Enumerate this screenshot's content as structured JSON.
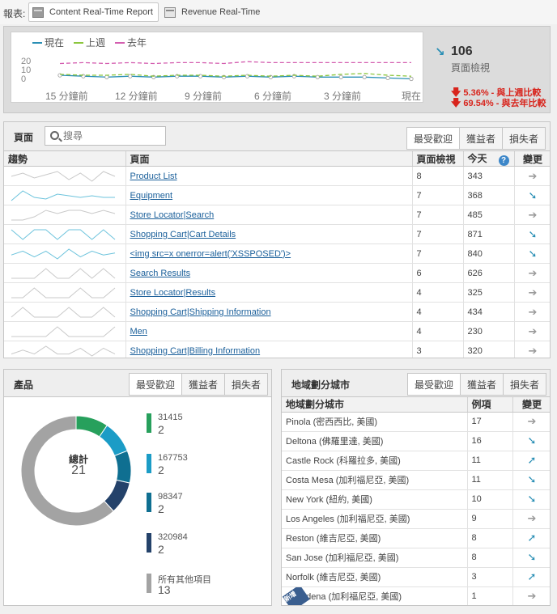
{
  "report": {
    "label": "報表:",
    "tabs": [
      {
        "label": "Content Real-Time Report",
        "active": true
      },
      {
        "label": "Revenue Real-Time",
        "active": false
      }
    ]
  },
  "overview": {
    "legend": [
      {
        "name": "現在",
        "color": "#2a8fb5"
      },
      {
        "name": "上週",
        "color": "#8cc63e"
      },
      {
        "name": "去年",
        "color": "#d45fb0"
      }
    ],
    "y_ticks": [
      "20",
      "10",
      "0"
    ],
    "x_ticks": [
      "15 分鐘前",
      "12 分鐘前",
      "9 分鐘前",
      "6 分鐘前",
      "3 分鐘前",
      "現在"
    ],
    "kpi_arrow": "↘",
    "kpi_value": "106",
    "kpi_label": "頁面檢視",
    "comparisons": [
      {
        "arrow": "🡇",
        "text": "5.36% - 與上週比較"
      },
      {
        "arrow": "🡇",
        "text": "69.54% - 與去年比較"
      }
    ],
    "chart_data": {
      "type": "line",
      "x": [
        "15 分鐘前",
        "12 分鐘前",
        "9 分鐘前",
        "6 分鐘前",
        "3 分鐘前",
        "現在"
      ],
      "ylim": [
        0,
        25
      ],
      "series": [
        {
          "name": "現在",
          "color": "#2a8fb5",
          "values": [
            8,
            7,
            6,
            7,
            6,
            7,
            7,
            6,
            7,
            6,
            7,
            6,
            6,
            6,
            5,
            4
          ]
        },
        {
          "name": "上週",
          "color": "#8cc63e",
          "values": [
            9,
            8,
            8,
            9,
            7,
            8,
            8,
            7,
            8,
            7,
            8,
            7,
            9,
            10,
            8,
            7
          ]
        },
        {
          "name": "去年",
          "color": "#d45fb0",
          "values": [
            21,
            22,
            21,
            22,
            21,
            22,
            22,
            21,
            23,
            22,
            22,
            22,
            22,
            22,
            22,
            22
          ]
        }
      ]
    }
  },
  "pages": {
    "title": "頁面",
    "search_placeholder": "搜尋",
    "tabs": [
      "最受歡迎",
      "獲益者",
      "損失者"
    ],
    "columns": [
      "趨勢",
      "頁面",
      "頁面檢視",
      "今天",
      "變更"
    ],
    "rows": [
      {
        "page": "Product List",
        "views": "8",
        "today": "343",
        "change": "flat",
        "spark": [
          6,
          8,
          5,
          7,
          9,
          4,
          8,
          3,
          9,
          6
        ]
      },
      {
        "page": "Equipment",
        "views": "7",
        "today": "368",
        "change": "down",
        "spark": [
          3,
          9,
          5,
          4,
          7,
          6,
          5,
          6,
          5,
          5
        ]
      },
      {
        "page": "Store Locator|Search",
        "views": "7",
        "today": "485",
        "change": "flat",
        "spark": [
          5,
          5,
          6,
          8,
          7,
          8,
          8,
          7,
          8,
          7
        ]
      },
      {
        "page": "Shopping Cart|Cart Details",
        "views": "7",
        "today": "871",
        "change": "down",
        "spark": [
          8,
          3,
          8,
          8,
          3,
          8,
          8,
          3,
          8,
          3
        ]
      },
      {
        "page": "<img src=x onerror=alert('XSSPOSED')>",
        "views": "7",
        "today": "840",
        "change": "down",
        "spark": [
          5,
          7,
          4,
          7,
          3,
          8,
          4,
          7,
          5,
          6
        ]
      },
      {
        "page": "Search Results",
        "views": "6",
        "today": "626",
        "change": "flat",
        "spark": [
          5,
          5,
          5,
          8,
          5,
          5,
          8,
          5,
          8,
          5
        ]
      },
      {
        "page": "Store Locator|Results",
        "views": "4",
        "today": "325",
        "change": "flat",
        "spark": [
          5,
          5,
          8,
          5,
          5,
          5,
          8,
          5,
          5,
          8
        ]
      },
      {
        "page": "Shopping Cart|Shipping Information",
        "views": "4",
        "today": "434",
        "change": "flat",
        "spark": [
          5,
          8,
          5,
          5,
          5,
          8,
          5,
          5,
          8,
          5
        ]
      },
      {
        "page": "Men",
        "views": "4",
        "today": "230",
        "change": "flat",
        "spark": [
          5,
          5,
          5,
          5,
          8,
          5,
          5,
          5,
          5,
          8
        ]
      },
      {
        "page": "Shopping Cart|Billing Information",
        "views": "3",
        "today": "320",
        "change": "flat",
        "spark": [
          5,
          7,
          5,
          9,
          5,
          5,
          8,
          4,
          8,
          5
        ]
      }
    ]
  },
  "products": {
    "title": "產品",
    "tabs": [
      "最受歡迎",
      "獲益者",
      "損失者"
    ],
    "total_label": "總計",
    "total_value": "21",
    "chart_data": {
      "type": "pie",
      "categories": [
        "31415",
        "167753",
        "98347",
        "320984",
        "所有其他項目"
      ],
      "values": [
        2,
        2,
        2,
        2,
        13
      ],
      "colors": [
        "#27a05c",
        "#1b9cc6",
        "#0f6f91",
        "#24426a",
        "#a3a3a3"
      ]
    }
  },
  "cities": {
    "title": "地域劃分城市",
    "tabs": [
      "最受歡迎",
      "獲益者",
      "損失者"
    ],
    "columns": [
      "地域劃分城市",
      "例項",
      "變更"
    ],
    "new_badge": "新增",
    "rows": [
      {
        "city": "Pinola (密西西比, 美國)",
        "count": "17",
        "change": "flat"
      },
      {
        "city": "Deltona (佛羅里達, 美國)",
        "count": "16",
        "change": "down"
      },
      {
        "city": "Castle Rock (科羅拉多, 美國)",
        "count": "11",
        "change": "up"
      },
      {
        "city": "Costa Mesa (加利福尼亞, 美國)",
        "count": "11",
        "change": "down"
      },
      {
        "city": "New York (紐約, 美國)",
        "count": "10",
        "change": "down"
      },
      {
        "city": "Los Angeles (加利福尼亞, 美國)",
        "count": "9",
        "change": "flat"
      },
      {
        "city": "Reston (維吉尼亞, 美國)",
        "count": "8",
        "change": "up"
      },
      {
        "city": "San Jose (加利福尼亞, 美國)",
        "count": "8",
        "change": "down"
      },
      {
        "city": "Norfolk (維吉尼亞, 美國)",
        "count": "3",
        "change": "up"
      },
      {
        "city": "Pasadena (加利福尼亞, 美國)",
        "count": "1",
        "change": "flat"
      }
    ]
  }
}
